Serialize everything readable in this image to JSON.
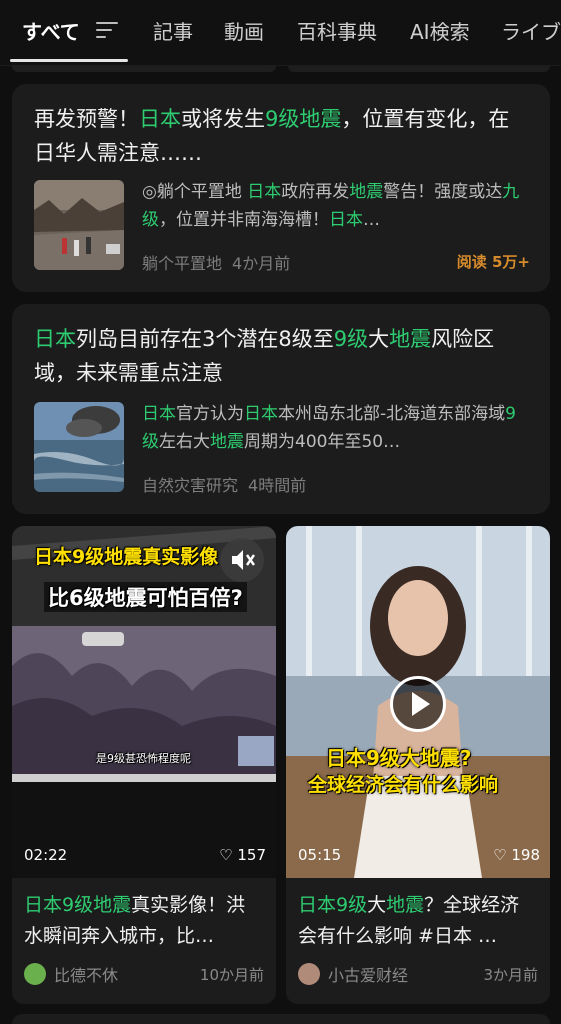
{
  "tabs": [
    {
      "label": "すべて",
      "active": true
    },
    {
      "label": "記事"
    },
    {
      "label": "動画"
    },
    {
      "label": "百科事典"
    },
    {
      "label": "AI検索"
    },
    {
      "label": "ライブ"
    }
  ],
  "accent_color": "#2ecc71",
  "reads_color": "#d68b2c",
  "news": [
    {
      "title_parts": [
        "再发预警！",
        "日本",
        "或将发生",
        "9级地震",
        "，位置有变化，在日华人需注意……"
      ],
      "snippet_parts": [
        "◎躺个平置地 ",
        "日本",
        "政府再发",
        "地震",
        "警告！强度或达",
        "九级",
        "，位置并非南海海槽！",
        "日本",
        "…"
      ],
      "source": "躺个平置地",
      "time": "4か月前",
      "reads": "阅读 5万+"
    },
    {
      "title_parts": [
        "日本",
        "列岛目前存在3个潜在8级至",
        "9级",
        "大",
        "地震",
        "风险区域，未来需重点注意"
      ],
      "snippet_parts": [
        "日本",
        "官方认为",
        "日本",
        "本州岛东北部-北海道东部海域",
        "9级",
        "左右大",
        "地震",
        "周期为400年至50…"
      ],
      "source": "自然灾害研究",
      "time": "4時間前"
    }
  ],
  "videos": [
    {
      "caption_top": "日本9级地震真实影像",
      "caption_bottom": "比6级地震可怕百倍?",
      "inner_caption": "是9级甚恐怖程度呢",
      "duration": "02:22",
      "likes": "157",
      "title_parts": [
        "日本9级地震",
        "真实影像！洪水瞬间奔入城市，比…"
      ],
      "author": "比德不休",
      "time": "10か月前"
    },
    {
      "caption_top": "日本9级大地震?",
      "caption_bottom": "全球经济会有什么影响",
      "duration": "05:15",
      "likes": "198",
      "title_parts": [
        "日本9级",
        "大",
        "地震",
        "？全球经济会有什么影响 #日本 …"
      ],
      "author": "小古爱财经",
      "time": "3か月前"
    }
  ]
}
